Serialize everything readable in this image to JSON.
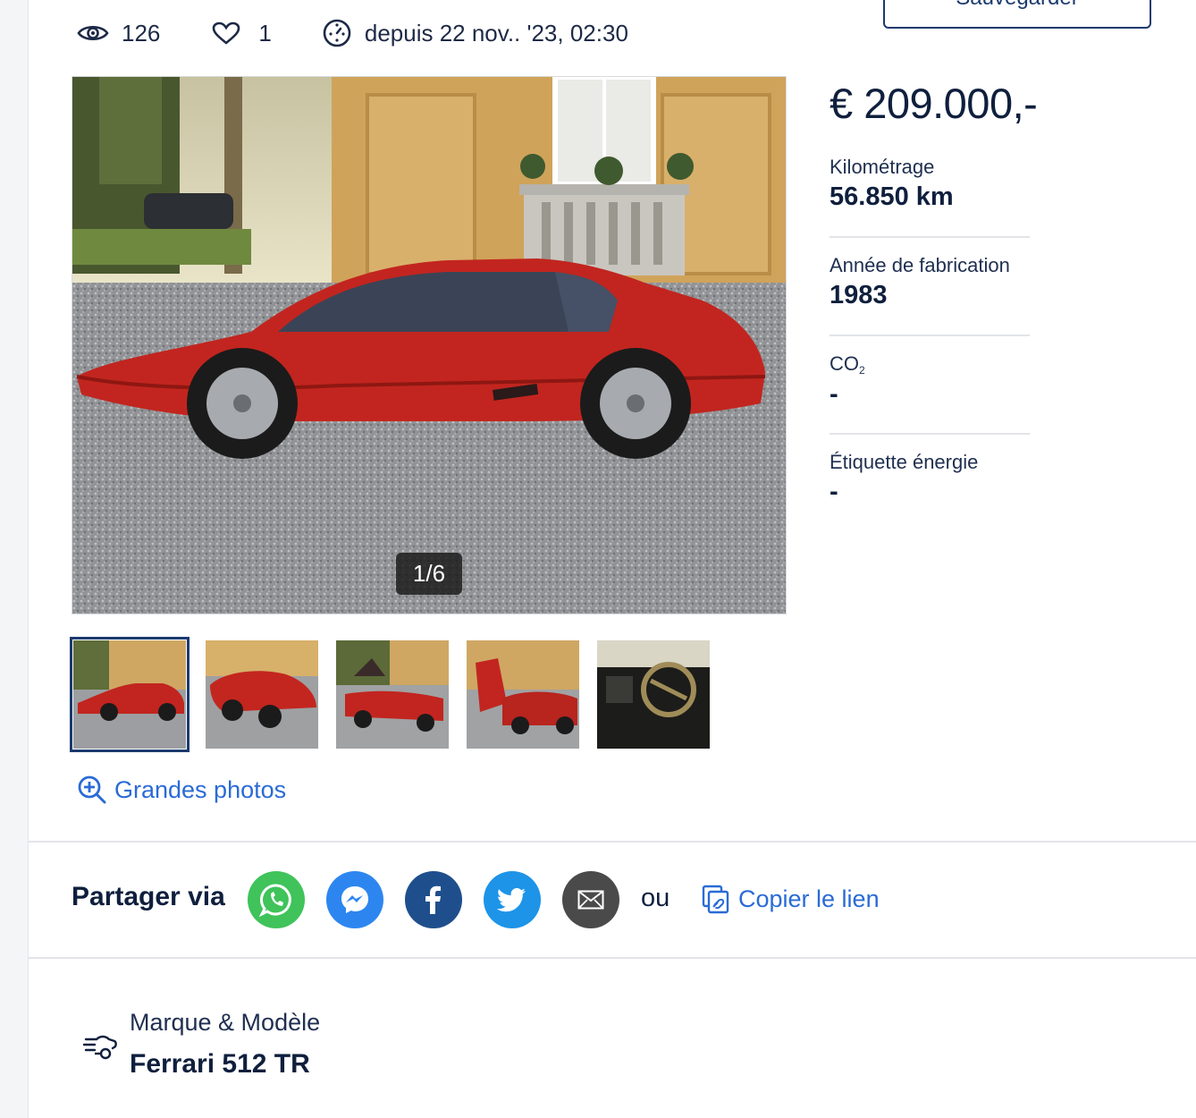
{
  "stats": {
    "views": "126",
    "likes": "1",
    "since": "depuis 22 nov.. '23, 02:30"
  },
  "save_button": {
    "label": "Sauvegarder"
  },
  "gallery": {
    "counter": "1/6",
    "thumbnails": [
      "photo-1",
      "photo-2",
      "photo-3",
      "photo-4",
      "photo-5"
    ],
    "big_photos_label": "Grandes photos"
  },
  "listing": {
    "price": "€ 209.000,-",
    "specs": [
      {
        "key": "Kilométrage",
        "value": "56.850 km"
      },
      {
        "key": "Année de fabrication",
        "value": "1983"
      },
      {
        "key": "CO",
        "key_sub": "2",
        "value": "-"
      },
      {
        "key": "Étiquette énergie",
        "value": "-"
      }
    ]
  },
  "share": {
    "title": "Partager via",
    "buttons": [
      {
        "name": "whatsapp",
        "color": "#3fc35a"
      },
      {
        "name": "messenger",
        "color": "#2d86f0"
      },
      {
        "name": "facebook",
        "color": "#1e4f8c"
      },
      {
        "name": "twitter",
        "color": "#1d94e8"
      },
      {
        "name": "email",
        "color": "#4a4a4a"
      }
    ],
    "or": "ou",
    "copy_link": "Copier le lien"
  },
  "make_model": {
    "label": "Marque & Modèle",
    "value": "Ferrari 512 TR"
  },
  "colors": {
    "navy": "#0f1f3d",
    "link_blue": "#2a6bd6",
    "border_navy": "#1b3a6e"
  }
}
